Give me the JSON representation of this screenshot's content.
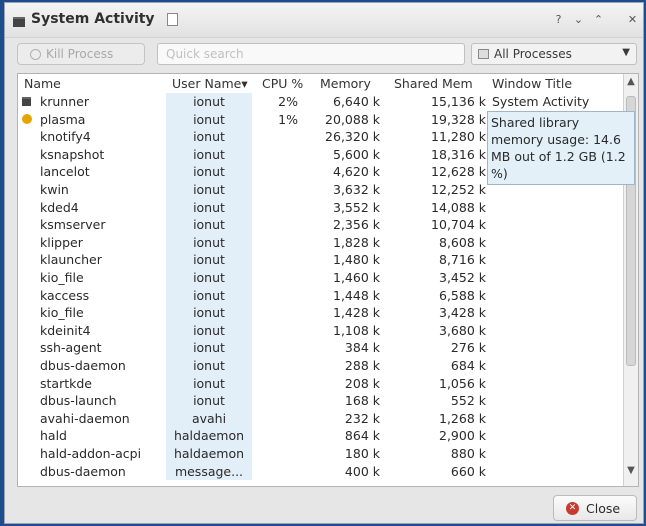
{
  "window": {
    "title": "System Activity"
  },
  "titlebar": {
    "help": "?",
    "minimize": "⌄",
    "maximize": "⌃",
    "close": "✕"
  },
  "toolbar": {
    "kill_label": "Kill Process",
    "search_placeholder": "Quick search",
    "filter_value": "All Processes"
  },
  "table": {
    "headers": [
      "Name",
      "User Name",
      "CPU %",
      "Memory",
      "Shared Mem",
      "Window Title"
    ],
    "sort_indicator": "▾",
    "rows": [
      {
        "name": "krunner",
        "user": "ionut",
        "cpu": "2%",
        "memory": "6,640 k",
        "shared": "15,136 k",
        "title": "System Activity",
        "icon": "krunner-icon"
      },
      {
        "name": "plasma",
        "user": "ionut",
        "cpu": "1%",
        "memory": "20,088 k",
        "shared": "19,328 k",
        "title": "",
        "icon": "plasma-icon"
      },
      {
        "name": "knotify4",
        "user": "ionut",
        "cpu": "",
        "memory": "26,320 k",
        "shared": "11,280 k",
        "title": ""
      },
      {
        "name": "ksnapshot",
        "user": "ionut",
        "cpu": "",
        "memory": "5,600 k",
        "shared": "18,316 k",
        "title": ""
      },
      {
        "name": "lancelot",
        "user": "ionut",
        "cpu": "",
        "memory": "4,620 k",
        "shared": "12,628 k",
        "title": ""
      },
      {
        "name": "kwin",
        "user": "ionut",
        "cpu": "",
        "memory": "3,632 k",
        "shared": "12,252 k",
        "title": ""
      },
      {
        "name": "kded4",
        "user": "ionut",
        "cpu": "",
        "memory": "3,552 k",
        "shared": "14,088 k",
        "title": ""
      },
      {
        "name": "ksmserver",
        "user": "ionut",
        "cpu": "",
        "memory": "2,356 k",
        "shared": "10,704 k",
        "title": ""
      },
      {
        "name": "klipper",
        "user": "ionut",
        "cpu": "",
        "memory": "1,828 k",
        "shared": "8,608 k",
        "title": ""
      },
      {
        "name": "klauncher",
        "user": "ionut",
        "cpu": "",
        "memory": "1,480 k",
        "shared": "8,716 k",
        "title": ""
      },
      {
        "name": "kio_file",
        "user": "ionut",
        "cpu": "",
        "memory": "1,460 k",
        "shared": "3,452 k",
        "title": ""
      },
      {
        "name": "kaccess",
        "user": "ionut",
        "cpu": "",
        "memory": "1,448 k",
        "shared": "6,588 k",
        "title": ""
      },
      {
        "name": "kio_file",
        "user": "ionut",
        "cpu": "",
        "memory": "1,428 k",
        "shared": "3,428 k",
        "title": ""
      },
      {
        "name": "kdeinit4",
        "user": "ionut",
        "cpu": "",
        "memory": "1,108 k",
        "shared": "3,680 k",
        "title": ""
      },
      {
        "name": "ssh-agent",
        "user": "ionut",
        "cpu": "",
        "memory": "384 k",
        "shared": "276 k",
        "title": ""
      },
      {
        "name": "dbus-daemon",
        "user": "ionut",
        "cpu": "",
        "memory": "288 k",
        "shared": "684 k",
        "title": ""
      },
      {
        "name": "startkde",
        "user": "ionut",
        "cpu": "",
        "memory": "208 k",
        "shared": "1,056 k",
        "title": ""
      },
      {
        "name": "dbus-launch",
        "user": "ionut",
        "cpu": "",
        "memory": "168 k",
        "shared": "552 k",
        "title": ""
      },
      {
        "name": "avahi-daemon",
        "user": "avahi",
        "cpu": "",
        "memory": "232 k",
        "shared": "1,268 k",
        "title": ""
      },
      {
        "name": "hald",
        "user": "haldaemon",
        "cpu": "",
        "memory": "864 k",
        "shared": "2,900 k",
        "title": ""
      },
      {
        "name": "hald-addon-acpi",
        "user": "haldaemon",
        "cpu": "",
        "memory": "180 k",
        "shared": "880 k",
        "title": ""
      },
      {
        "name": "dbus-daemon",
        "user": "message...",
        "cpu": "",
        "memory": "400 k",
        "shared": "660 k",
        "title": ""
      }
    ]
  },
  "tooltip": {
    "text": "Shared library memory usage: 14.6 MB out of 1.2 GB (1.2 %)"
  },
  "footer": {
    "close_label": "Close"
  },
  "colors": {
    "user_highlight": "#e2eef8",
    "desktop_bg": "#1d4d8c",
    "close_icon": "#c93a2e"
  }
}
